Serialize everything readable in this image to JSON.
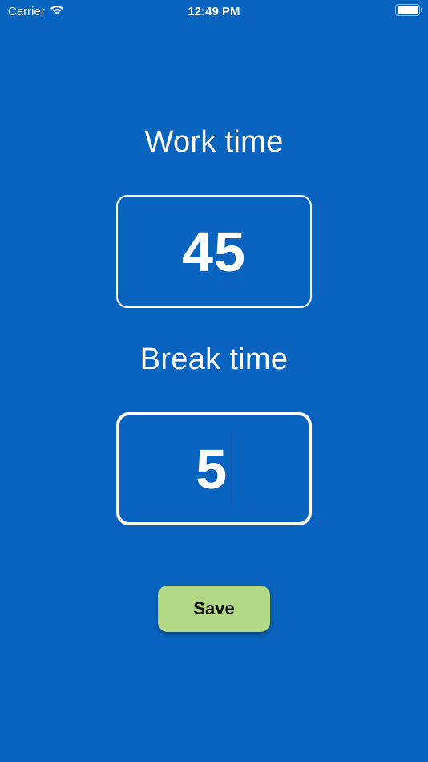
{
  "status_bar": {
    "carrier": "Carrier",
    "time": "12:49 PM",
    "icons": [
      "wifi-icon",
      "battery-icon"
    ]
  },
  "work": {
    "label": "Work time",
    "value": "45"
  },
  "break": {
    "label": "Break time",
    "value": "5"
  },
  "save_button": {
    "label": "Save"
  },
  "colors": {
    "background": "#0864BF",
    "text": "#FFFFFF",
    "save_button": "#B2D785"
  }
}
